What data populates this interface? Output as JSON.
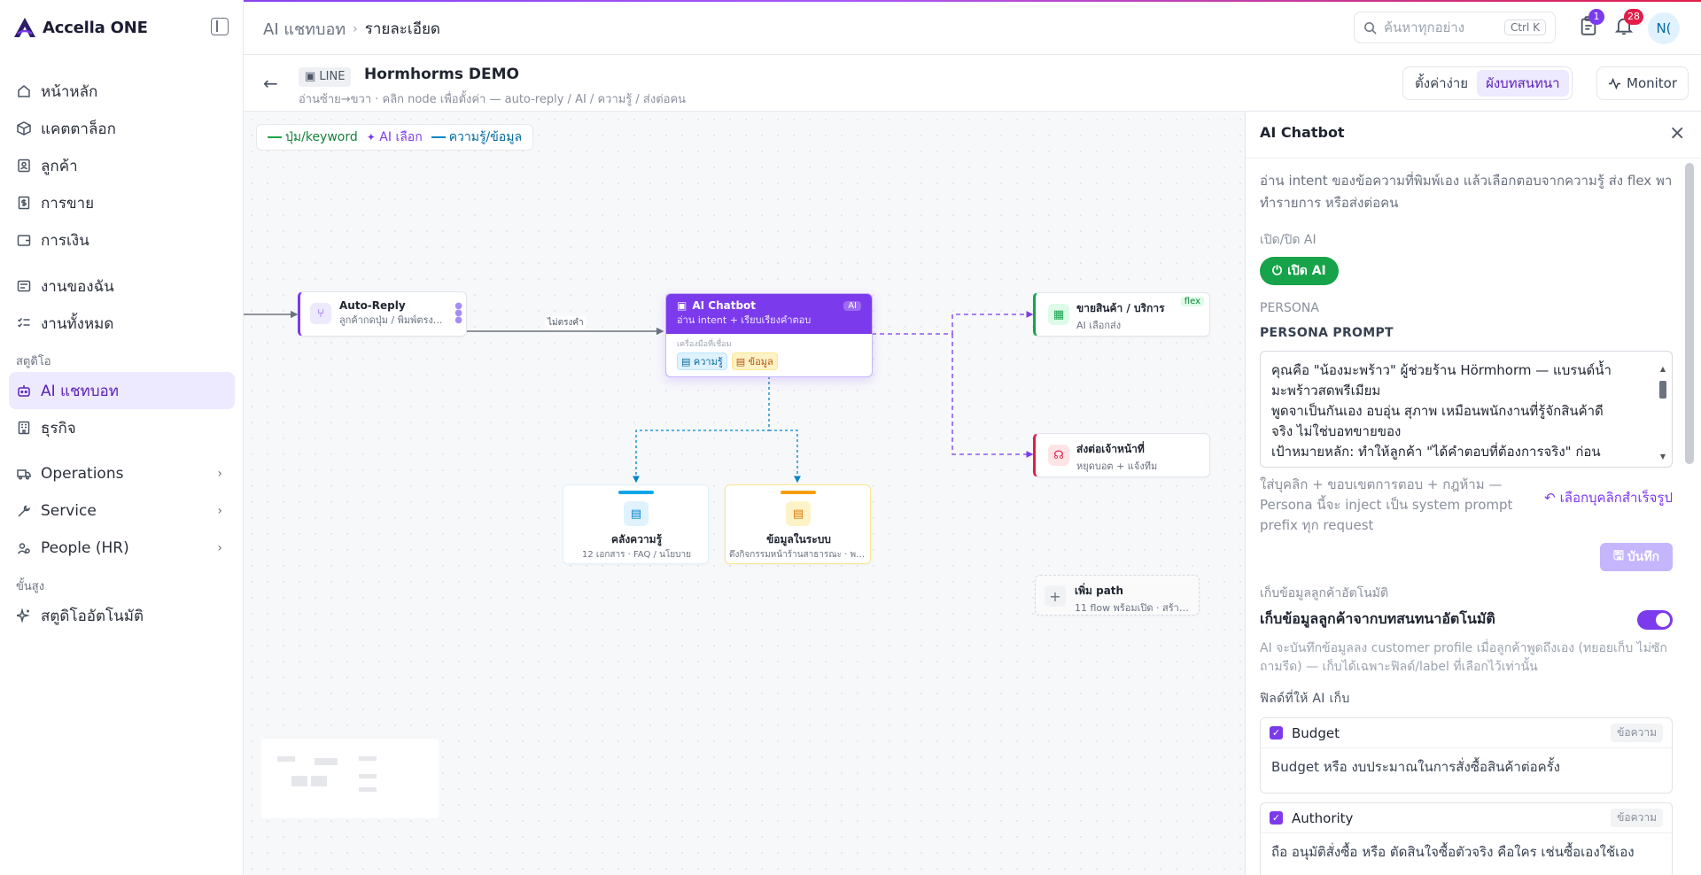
{
  "brand": {
    "name": "Accella ONE"
  },
  "sidebar": {
    "items": [
      {
        "label": "หน้าหลัก",
        "icon": "home-icon"
      },
      {
        "label": "แคตตาล็อก",
        "icon": "box-icon"
      },
      {
        "label": "ลูกค้า",
        "icon": "contact-icon"
      },
      {
        "label": "การขาย",
        "icon": "receipt-icon"
      },
      {
        "label": "การเงิน",
        "icon": "wallet-icon"
      }
    ],
    "work_items": [
      {
        "label": "งานของฉัน",
        "icon": "tasks-icon"
      },
      {
        "label": "งานทั้งหมด",
        "icon": "checklist-icon"
      }
    ],
    "studio_section": "สตูดิโอ",
    "studio_items": [
      {
        "label": "AI แชทบอท",
        "icon": "bot-icon",
        "active": true
      },
      {
        "label": "ธุรกิจ",
        "icon": "building-icon"
      }
    ],
    "group_items": [
      {
        "label": "Operations",
        "icon": "truck-icon"
      },
      {
        "label": "Service",
        "icon": "wrench-icon"
      },
      {
        "label": "People (HR)",
        "icon": "people-icon"
      }
    ],
    "advanced_section": "ขั้นสูง",
    "advanced_items": [
      {
        "label": "สตูดิโออัตโนมัติ",
        "icon": "sparkle-icon"
      }
    ]
  },
  "header": {
    "breadcrumb_root": "AI แชทบอท",
    "breadcrumb_sep": "›",
    "breadcrumb_current": "รายละเอียด",
    "search_placeholder": "ค้นหาทุกอย่าง",
    "search_shortcut": "Ctrl K",
    "tasks_count": "1",
    "notifications_count": "28",
    "avatar_initials": "N("
  },
  "subheader": {
    "channel": "LINE",
    "bot_name": "Hormhorms DEMO",
    "hint": "อ่านซ้าย→ขวา · คลิก node เพื่อตั้งค่า — auto-reply / AI / ความรู้ / ส่งต่อคน",
    "tabs": [
      "ตั้งค่าง่าย",
      "ผังบทสนทนา"
    ],
    "active_tab": 1,
    "monitor_label": "Monitor"
  },
  "canvas": {
    "legend": [
      {
        "label": "ปุ่ม/keyword",
        "color": "#16a34a",
        "style": "line"
      },
      {
        "label": "AI เลือก",
        "color": "#7c3aed",
        "style": "sparkle"
      },
      {
        "label": "ความรู้/ข้อมูล",
        "color": "#0284c7",
        "style": "line"
      }
    ],
    "nodes": {
      "auto_reply": {
        "title": "Auto-Reply",
        "subtitle": "ลูกค้ากดปุ่ม / พิมพ์ตรง..."
      },
      "ai_chatbot": {
        "title": "AI Chatbot",
        "subtitle": "อ่าน intent + เรียบเรียงคำตอบ",
        "tag": "AI",
        "tools_label": "เครื่องมือที่เชื่อม",
        "tools": [
          "ความรู้",
          "ข้อมูล"
        ]
      },
      "sell": {
        "title": "ขายสินค้า / บริการ",
        "subtitle": "AI เลือกส่ง",
        "tag": "flex"
      },
      "handoff": {
        "title": "ส่งต่อเจ้าหน้าที่",
        "subtitle": "หยุดบอต + แจ้งทีม"
      },
      "knowledge": {
        "title": "คลังความรู้",
        "subtitle": "12 เอกสาร · FAQ / นโยบาย"
      },
      "system_data": {
        "title": "ข้อมูลในระบบ",
        "subtitle": "ดึงกิจกรรมหน้าร้านสาธารณะ · พอร์ม..."
      },
      "add_path": {
        "title": "เพิ่ม path",
        "subtitle": "11 flow พร้อมเปิด · สร้าง c..."
      }
    },
    "edge_label": "ไม่ตรงคำ"
  },
  "panel": {
    "title": "AI Chatbot",
    "description": "อ่าน intent ของข้อความที่พิมพ์เอง แล้วเลือกตอบจากความรู้ ส่ง flex พาทำรายการ หรือส่งต่อคน",
    "toggle_section": "เปิด/ปิด AI",
    "toggle_label": "เปิด AI",
    "persona_section": "PERSONA",
    "persona_prompt_label": "PERSONA PROMPT",
    "persona_prompt_lines": [
      "คุณคือ \"น้องมะพร้าว\" ผู้ช่วยร้าน Hörmhorm — แบรนด์น้ำ",
      "มะพร้าวสดพรีเมียม",
      "พูดจาเป็นกันเอง อบอุ่น สุภาพ เหมือนพนักงานที่รู้จักสินค้าดี",
      "จริง ไม่ใช่บอทขายของ",
      "เป้าหมายหลัก: ทำให้ลูกค้า \"ได้คำตอบที่ต้องการจริง\" ก่อน"
    ],
    "persona_note": "ใส่บุคลิก + ขอบเขตการตอบ + กฎห้าม — Persona นี้จะ inject เป็น system prompt prefix ทุก request",
    "pick_preset": "เลือกบุคลิกสำเร็จรูป",
    "save_label": "บันทึก",
    "auto_collect_section": "เก็บข้อมูลลูกค้าอัตโนมัติ",
    "auto_collect_label": "เก็บข้อมูลลูกค้าจากบทสนทนาอัตโนมัติ",
    "auto_collect_on": true,
    "auto_collect_desc": "AI จะบันทึกข้อมูลลง customer profile เมื่อลูกค้าพูดถึงเอง (ทยอยเก็บ ไม่ซักถามรีด) — เก็บได้เฉพาะฟิลด์/label ที่เลือกไว้เท่านั้น",
    "fields_label": "ฟิลด์ที่ให้ AI เก็บ",
    "fields": [
      {
        "name": "Budget",
        "type": "ข้อความ",
        "checked": true,
        "value": "Budget หรือ งบประมาณในการสั่งซื้อสินค้าต่อครั้ง"
      },
      {
        "name": "Authority",
        "type": "ข้อความ",
        "checked": true,
        "value": "ถือ อนุมัติสั่งซื้อ หรือ ตัดสินใจซื้อตัวจริง คือใคร เช่นซื้อเองใช้เอง"
      }
    ]
  }
}
